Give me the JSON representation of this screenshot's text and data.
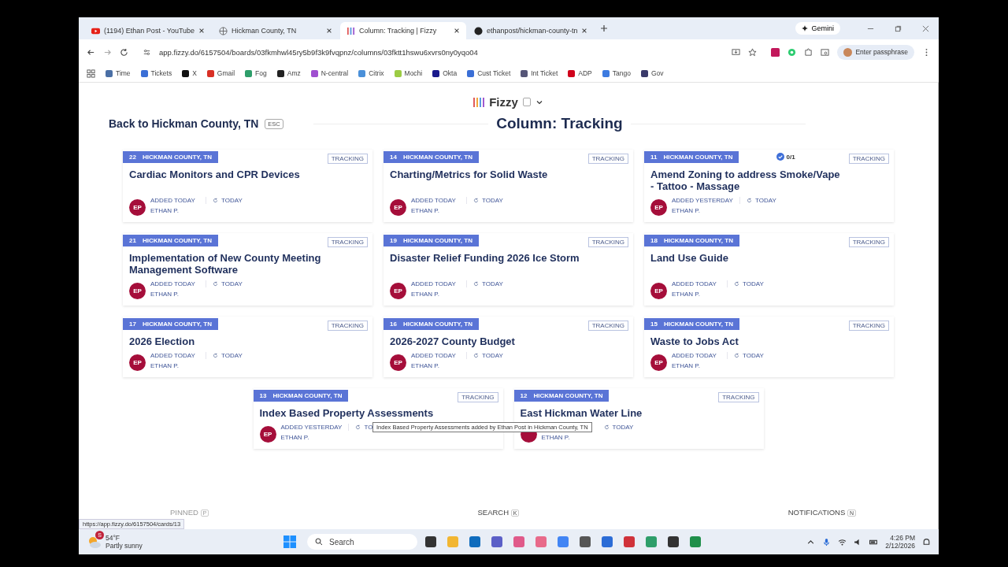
{
  "browser": {
    "tabs": [
      {
        "title": "(1194) Ethan Post - YouTube",
        "selected": false
      },
      {
        "title": "Hickman County, TN",
        "selected": false
      },
      {
        "title": "Column: Tracking | Fizzy",
        "selected": true
      },
      {
        "title": "ethanpost/hickman-county-tn",
        "selected": false
      }
    ],
    "gemini_button": "Gemini",
    "url": "app.fizzy.do/6157504/boards/03fkmhwl45ry5b9f3k9fvqpnz/columns/03fktt1hswu6xvrs0ny0yqo04",
    "passphrase_button": "Enter passphrase",
    "bookmarks": [
      {
        "label": "Time",
        "color": "#4a6fa5"
      },
      {
        "label": "Tickets",
        "color": "#3b6fd6"
      },
      {
        "label": "X",
        "color": "#111111"
      },
      {
        "label": "Gmail",
        "color": "#d93025"
      },
      {
        "label": "Fog",
        "color": "#2e9e6a"
      },
      {
        "label": "Amz",
        "color": "#222222"
      },
      {
        "label": "N-central",
        "color": "#a04fd0"
      },
      {
        "label": "Citrix",
        "color": "#4a90d9"
      },
      {
        "label": "Mochi",
        "color": "#9ccc44"
      },
      {
        "label": "Okta",
        "color": "#1a1a8c"
      },
      {
        "label": "Cust Ticket",
        "color": "#3b6fd6"
      },
      {
        "label": "Int Ticket",
        "color": "#555577"
      },
      {
        "label": "ADP",
        "color": "#d0021b"
      },
      {
        "label": "Tango",
        "color": "#3d7be0"
      },
      {
        "label": "Gov",
        "color": "#3a3a6a"
      }
    ]
  },
  "app": {
    "name": "Fizzy",
    "back_link": "Back to Hickman County, TN",
    "back_key": "ESC",
    "heading": "Column: Tracking",
    "cards": [
      {
        "number": "22",
        "board": "HICKMAN COUNTY, TN",
        "tag": "TRACKING",
        "title": "Cardiac Monitors and CPR Devices",
        "avatar": "EP",
        "added": "ADDED TODAY",
        "updated": "TODAY",
        "author": "ETHAN P."
      },
      {
        "number": "14",
        "board": "HICKMAN COUNTY, TN",
        "tag": "TRACKING",
        "title": "Charting/Metrics for Solid Waste",
        "avatar": "EP",
        "added": "ADDED TODAY",
        "updated": "TODAY",
        "author": "ETHAN P."
      },
      {
        "number": "11",
        "board": "HICKMAN COUNTY, TN",
        "tag": "TRACKING",
        "title": "Amend Zoning to address Smoke/Vape - Tattoo - Massage",
        "steps": "0/1",
        "avatar": "EP",
        "added": "ADDED YESTERDAY",
        "updated": "TODAY",
        "author": "ETHAN P."
      },
      {
        "number": "21",
        "board": "HICKMAN COUNTY, TN",
        "tag": "TRACKING",
        "title": "Implementation of New County Meeting Management Software",
        "avatar": "EP",
        "added": "ADDED TODAY",
        "updated": "TODAY",
        "author": "ETHAN P."
      },
      {
        "number": "19",
        "board": "HICKMAN COUNTY, TN",
        "tag": "TRACKING",
        "title": "Disaster Relief Funding 2026 Ice Storm",
        "avatar": "EP",
        "added": "ADDED TODAY",
        "updated": "TODAY",
        "author": "ETHAN P."
      },
      {
        "number": "18",
        "board": "HICKMAN COUNTY, TN",
        "tag": "TRACKING",
        "title": "Land Use Guide",
        "avatar": "EP",
        "added": "ADDED TODAY",
        "updated": "TODAY",
        "author": "ETHAN P."
      },
      {
        "number": "17",
        "board": "HICKMAN COUNTY, TN",
        "tag": "TRACKING",
        "title": "2026 Election",
        "avatar": "EP",
        "added": "ADDED TODAY",
        "updated": "TODAY",
        "author": "ETHAN P."
      },
      {
        "number": "16",
        "board": "HICKMAN COUNTY, TN",
        "tag": "TRACKING",
        "title": "2026-2027 County Budget",
        "avatar": "EP",
        "added": "ADDED TODAY",
        "updated": "TODAY",
        "author": "ETHAN P."
      },
      {
        "number": "15",
        "board": "HICKMAN COUNTY, TN",
        "tag": "TRACKING",
        "title": "Waste to Jobs Act",
        "avatar": "EP",
        "added": "ADDED TODAY",
        "updated": "TODAY",
        "author": "ETHAN P."
      },
      {
        "number": "13",
        "board": "HICKMAN COUNTY, TN",
        "tag": "TRACKING",
        "title": "Index Based Property Assessments",
        "avatar": "EP",
        "added": "ADDED YESTERDAY",
        "updated": "TO",
        "author": "ETHAN P."
      },
      {
        "number": "12",
        "board": "HICKMAN COUNTY, TN",
        "tag": "TRACKING",
        "title": "East Hickman Water Line",
        "updated": "TODAY",
        "author": "ETHAN P."
      }
    ],
    "tooltip": "Index Based Property Assessments added by Ethan Post in Hickman County, TN",
    "footer": [
      {
        "label": "PINNED",
        "key": "P",
        "disabled": true
      },
      {
        "label": "SEARCH",
        "key": "K",
        "disabled": false
      },
      {
        "label": "NOTIFICATIONS",
        "key": "N",
        "disabled": false
      }
    ]
  },
  "status_url": "https://app.fizzy.do/6157504/cards/13",
  "taskbar": {
    "weather_badge": "S",
    "weather_temp": "54°F",
    "weather_text": "Partly sunny",
    "search_placeholder": "Search",
    "time": "4:26 PM",
    "date": "2/12/2026"
  }
}
